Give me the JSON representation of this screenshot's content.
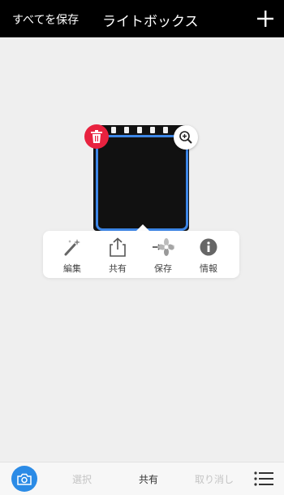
{
  "topbar": {
    "save_all_label": "すべてを保存",
    "title": "ライトボックス",
    "add_icon": "plus-icon"
  },
  "photo": {
    "delete_icon": "trash-icon",
    "zoom_icon": "zoom-in-icon"
  },
  "popup_menu": {
    "items": [
      {
        "label": "編集",
        "icon": "magic-wand-icon"
      },
      {
        "label": "共有",
        "icon": "share-icon"
      },
      {
        "label": "保存",
        "icon": "photos-icon"
      },
      {
        "label": "情報",
        "icon": "info-icon"
      }
    ]
  },
  "bottombar": {
    "camera_icon": "camera-icon",
    "select_label": "選択",
    "share_label": "共有",
    "cancel_label": "取り消し",
    "menu_icon": "list-icon"
  },
  "colors": {
    "accent": "#2b8be6",
    "frame_border": "#3d86e6",
    "delete": "#e8223f",
    "topbar_bg": "#000000"
  }
}
